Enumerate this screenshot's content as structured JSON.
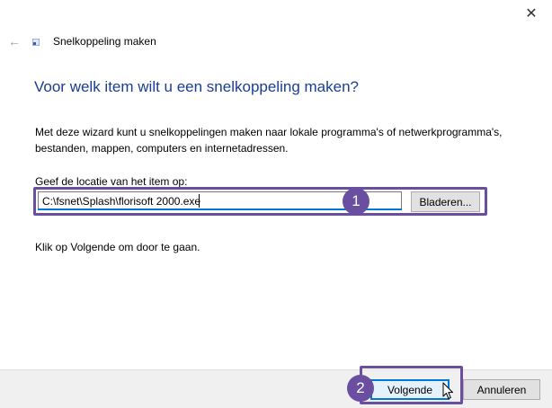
{
  "window": {
    "title": "Snelkoppeling maken",
    "close_glyph": "✕",
    "back_glyph": "←"
  },
  "wizard": {
    "heading": "Voor welk item wilt u een snelkoppeling maken?",
    "description": "Met deze wizard kunt u snelkoppelingen maken naar lokale programma's of netwerkprogramma's, bestanden, mappen, computers en internetadressen.",
    "location_label": "Geef de locatie van het item op:",
    "location_value": "C:\\fsnet\\Splash\\florisoft 2000.exe",
    "browse_label": "Bladeren...",
    "hint": "Klik op Volgende om door te gaan."
  },
  "footer": {
    "next_label": "Volgende",
    "cancel_label": "Annuleren"
  },
  "annotations": {
    "step1": "1",
    "step2": "2",
    "highlight_color": "#6a4fa0"
  },
  "colors": {
    "heading": "#1a3e91",
    "focus": "#0078d7",
    "footer_bg": "#f0f0f0"
  },
  "icons": [
    "close-icon",
    "back-arrow-icon",
    "shortcut-icon",
    "mouse-cursor-icon"
  ]
}
